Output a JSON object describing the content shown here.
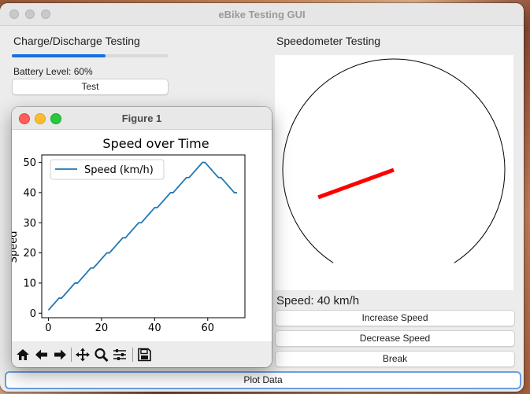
{
  "window": {
    "title": "eBike Testing GUI"
  },
  "charge": {
    "section_title": "Charge/Discharge Testing",
    "battery_level": 0.6,
    "battery_label": "Battery Level: 60%",
    "test_button": "Test"
  },
  "speedo": {
    "section_title": "Speedometer Testing",
    "speed_value": 40,
    "speed_label": "Speed: 40 km/h",
    "buttons": {
      "increase": "Increase Speed",
      "decrease": "Decrease Speed",
      "brake": "Break"
    },
    "needle_color": "#ff0000"
  },
  "plot_button": "Plot Data",
  "figure": {
    "title": "Figure 1",
    "toolbar": [
      "home-icon",
      "back-arrow-icon",
      "forward-arrow-icon",
      "pan-icon",
      "zoom-icon",
      "configure-icon",
      "save-icon"
    ]
  },
  "chart_data": {
    "type": "line",
    "title": "Speed over Time",
    "xlabel": "",
    "ylabel": "Speed",
    "xlim": [
      -2.5,
      74
    ],
    "ylim": [
      -1.5,
      52.5
    ],
    "xticks": [
      0,
      20,
      40,
      60
    ],
    "yticks": [
      0,
      10,
      20,
      30,
      40,
      50
    ],
    "legend": "upper left",
    "series": [
      {
        "name": "Speed (km/h)",
        "color": "#1f77b4",
        "x": [
          0,
          1,
          2,
          3,
          4,
          5,
          6,
          7,
          8,
          9,
          10,
          11,
          12,
          13,
          14,
          15,
          16,
          17,
          18,
          19,
          20,
          21,
          22,
          23,
          24,
          25,
          26,
          27,
          28,
          29,
          30,
          31,
          32,
          33,
          34,
          35,
          36,
          37,
          38,
          39,
          40,
          41,
          42,
          43,
          44,
          45,
          46,
          47,
          48,
          49,
          50,
          51,
          52,
          53,
          54,
          55,
          56,
          57,
          58,
          59,
          60,
          61,
          62,
          63,
          64,
          65,
          66,
          67,
          68,
          69,
          70,
          71
        ],
        "y": [
          1,
          2,
          3,
          4,
          5,
          5,
          6,
          7,
          8,
          9,
          10,
          10,
          11,
          12,
          13,
          14,
          15,
          15,
          16,
          17,
          18,
          19,
          20,
          20,
          21,
          22,
          23,
          24,
          25,
          25,
          26,
          27,
          28,
          29,
          30,
          30,
          31,
          32,
          33,
          34,
          35,
          35,
          36,
          37,
          38,
          39,
          40,
          40,
          41,
          42,
          43,
          44,
          45,
          45,
          46,
          47,
          48,
          49,
          50,
          50,
          49,
          48,
          47,
          46,
          45,
          45,
          44,
          43,
          42,
          41,
          40,
          40
        ]
      }
    ]
  }
}
